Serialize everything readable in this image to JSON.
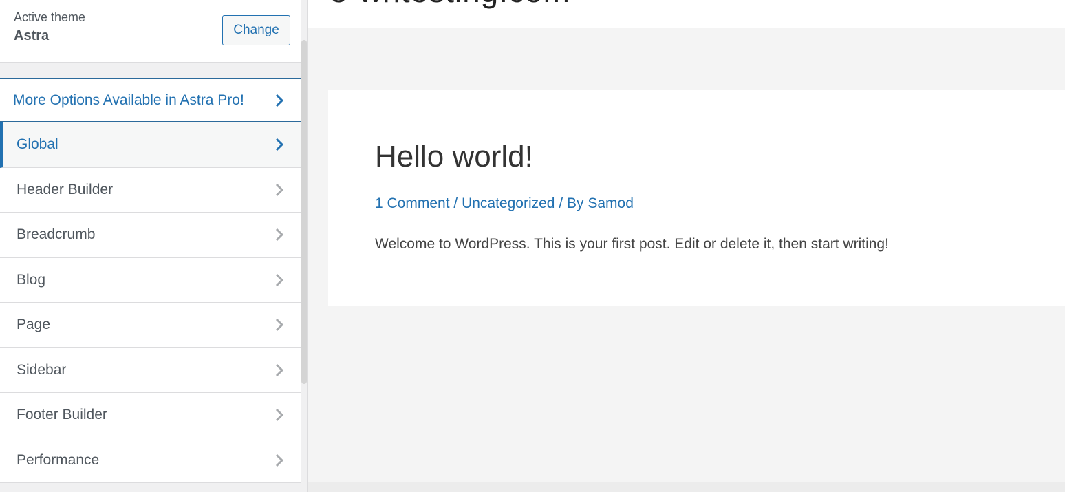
{
  "sidebar": {
    "active_theme_label": "Active theme",
    "active_theme_name": "Astra",
    "change_button": "Change",
    "pro_item": "More Options Available in Astra Pro!",
    "items": [
      {
        "label": "Global",
        "active": true
      },
      {
        "label": "Header Builder",
        "active": false
      },
      {
        "label": "Breadcrumb",
        "active": false
      },
      {
        "label": "Blog",
        "active": false
      },
      {
        "label": "Page",
        "active": false
      },
      {
        "label": "Sidebar",
        "active": false
      },
      {
        "label": "Footer Builder",
        "active": false
      },
      {
        "label": "Performance",
        "active": false
      }
    ]
  },
  "preview": {
    "site_title": "e-whtesting.com",
    "post": {
      "title": "Hello world!",
      "meta": {
        "comments": "1 Comment",
        "sep1": " / ",
        "category": "Uncategorized",
        "sep2": " / By ",
        "author": "Samod"
      },
      "excerpt": "Welcome to WordPress. This is your first post. Edit or delete it, then start writing!"
    }
  },
  "colors": {
    "accent": "#2271b1",
    "text": "#50575e",
    "chevron_inactive": "#a7aaad"
  }
}
